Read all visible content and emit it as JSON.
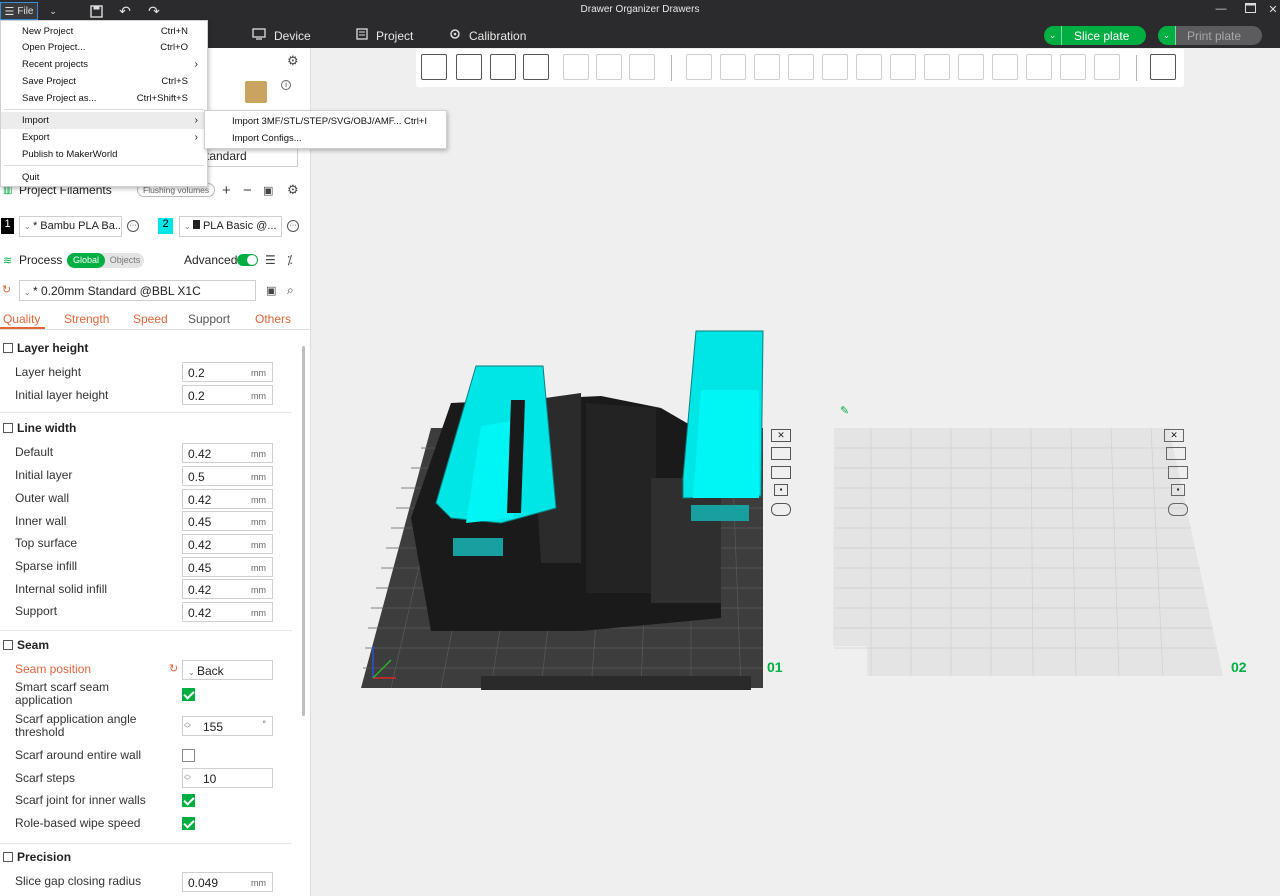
{
  "window": {
    "title": "Drawer Organizer Drawers",
    "file_label": "File"
  },
  "topbar": {
    "tabs": [
      {
        "label": "Device",
        "icon": "device-icon"
      },
      {
        "label": "Project",
        "icon": "project-icon"
      },
      {
        "label": "Calibration",
        "icon": "calibration-icon"
      }
    ],
    "slice_label": "Slice plate",
    "print_label": "Print plate",
    "accent": "#00ae42"
  },
  "file_menu": {
    "items": [
      {
        "label": "New Project",
        "shortcut": "Ctrl+N"
      },
      {
        "label": "Open Project...",
        "shortcut": "Ctrl+O"
      },
      {
        "label": "Recent projects",
        "shortcut": ""
      },
      {
        "label": "Save Project",
        "shortcut": "Ctrl+S"
      },
      {
        "label": "Save Project as...",
        "shortcut": "Ctrl+Shift+S"
      },
      {
        "label": "Import",
        "shortcut": ""
      },
      {
        "label": "Export",
        "shortcut": ""
      },
      {
        "label": "Publish to MakerWorld",
        "shortcut": ""
      },
      {
        "label": "Quit",
        "shortcut": ""
      }
    ]
  },
  "import_submenu": {
    "items": [
      {
        "label": "Import 3MF/STL/STEP/SVG/OBJ/AMF...",
        "shortcut": "Ctrl+I"
      },
      {
        "label": "Import Configs..."
      }
    ]
  },
  "sidebar": {
    "plate_type_partial": "tandard",
    "filaments": {
      "title": "Project Filaments",
      "flushing_label": "Flushing volumes",
      "slots": [
        {
          "num": "1",
          "name": "* Bambu PLA Ba...",
          "color": "#000000"
        },
        {
          "num": "2",
          "name": "PLA Basic @...",
          "color": "#00e5e5"
        }
      ]
    },
    "process": {
      "title": "Process",
      "global_label": "Global",
      "objects_label": "Objects",
      "advanced_label": "Advanced",
      "preset": "* 0.20mm Standard @BBL X1C"
    },
    "tabs": [
      "Quality",
      "Strength",
      "Speed",
      "Support",
      "Others"
    ],
    "groups": {
      "layer_height": {
        "title": "Layer height",
        "rows": [
          {
            "label": "Layer height",
            "value": "0.2",
            "unit": "mm"
          },
          {
            "label": "Initial layer height",
            "value": "0.2",
            "unit": "mm"
          }
        ]
      },
      "line_width": {
        "title": "Line width",
        "rows": [
          {
            "label": "Default",
            "value": "0.42",
            "unit": "mm"
          },
          {
            "label": "Initial layer",
            "value": "0.5",
            "unit": "mm"
          },
          {
            "label": "Outer wall",
            "value": "0.42",
            "unit": "mm"
          },
          {
            "label": "Inner wall",
            "value": "0.45",
            "unit": "mm"
          },
          {
            "label": "Top surface",
            "value": "0.42",
            "unit": "mm"
          },
          {
            "label": "Sparse infill",
            "value": "0.45",
            "unit": "mm"
          },
          {
            "label": "Internal solid infill",
            "value": "0.42",
            "unit": "mm"
          },
          {
            "label": "Support",
            "value": "0.42",
            "unit": "mm"
          }
        ]
      },
      "seam": {
        "title": "Seam",
        "seam_position_label": "Seam position",
        "seam_position_value": "Back",
        "smart_scarf_label": "Smart scarf seam application",
        "scarf_angle_label": "Scarf application angle threshold",
        "scarf_angle_value": "155",
        "scarf_angle_unit": "°",
        "scarf_entire_label": "Scarf around entire wall",
        "scarf_steps_label": "Scarf steps",
        "scarf_steps_value": "10",
        "scarf_inner_label": "Scarf joint for inner walls",
        "role_wipe_label": "Role-based wipe speed"
      },
      "precision": {
        "title": "Precision",
        "rows": [
          {
            "label": "Slice gap closing radius",
            "value": "0.049",
            "unit": "mm"
          }
        ]
      }
    }
  },
  "viewport": {
    "plate1_label": "01",
    "plate2_label": "02",
    "model_color": "#00e5e5",
    "accent": "#00ae42"
  }
}
